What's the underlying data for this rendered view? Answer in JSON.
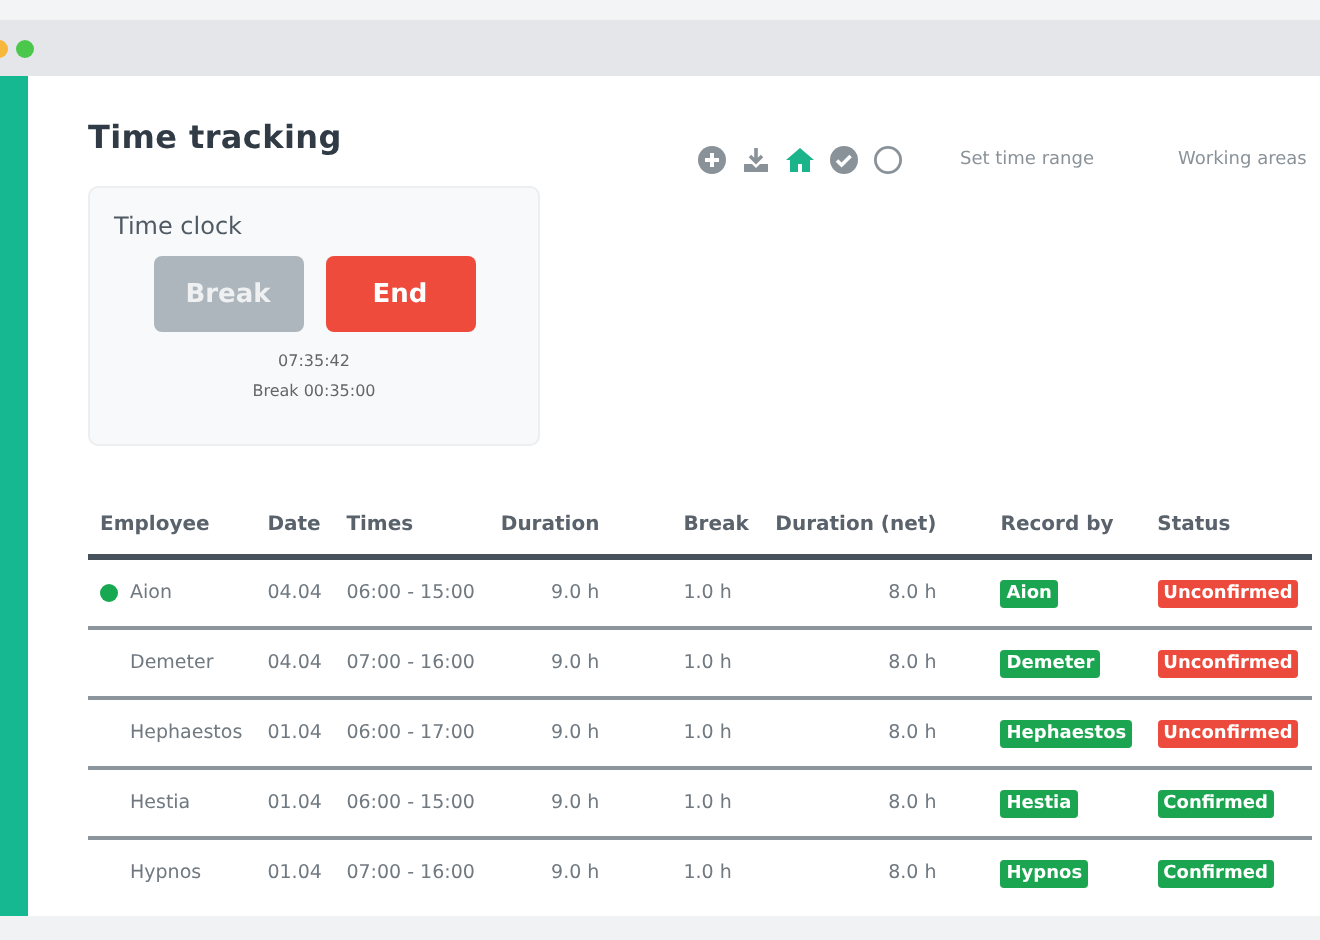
{
  "window": {
    "controls": [
      {
        "kind": "minimize"
      },
      {
        "kind": "maximize"
      }
    ]
  },
  "title": "Time tracking",
  "toolbar": {
    "icons": [
      {
        "kind": "add",
        "selected": false
      },
      {
        "kind": "download",
        "selected": false
      },
      {
        "kind": "home",
        "selected": true
      },
      {
        "kind": "check",
        "selected": false
      },
      {
        "kind": "circle",
        "selected": false
      }
    ],
    "links": [
      "Set time range",
      "Working areas"
    ]
  },
  "time_clock": {
    "title": "Time clock",
    "buttons": [
      {
        "label": "Break",
        "kind": "secondary"
      },
      {
        "label": "End",
        "kind": "danger"
      }
    ],
    "elapsed": "07:35:42",
    "break": "Break 00:35:00"
  },
  "table": {
    "columns": [
      "Employee",
      "Date",
      "Times",
      "Duration",
      "Break",
      "Duration (net)",
      "Record by",
      "Status"
    ],
    "rows": [
      {
        "employee": "Aion",
        "online": true,
        "date": "04.04",
        "times": "06:00 - 15:00",
        "duration": "9.0 h",
        "break": "1.0 h",
        "net": "8.0 h",
        "record_by": "Aion",
        "status": "Unconfirmed",
        "confirmed": false
      },
      {
        "employee": "Demeter",
        "online": false,
        "date": "04.04",
        "times": "07:00 - 16:00",
        "duration": "9.0 h",
        "break": "1.0 h",
        "net": "8.0 h",
        "record_by": "Demeter",
        "status": "Unconfirmed",
        "confirmed": false
      },
      {
        "employee": "Hephaestos",
        "online": false,
        "date": "01.04",
        "times": "06:00 - 17:00",
        "duration": "9.0 h",
        "break": "1.0 h",
        "net": "8.0 h",
        "record_by": "Hephaestos",
        "status": "Unconfirmed",
        "confirmed": false
      },
      {
        "employee": "Hestia",
        "online": false,
        "date": "01.04",
        "times": "06:00 - 15:00",
        "duration": "9.0 h",
        "break": "1.0 h",
        "net": "8.0 h",
        "record_by": "Hestia",
        "status": "Confirmed",
        "confirmed": true
      },
      {
        "employee": "Hypnos",
        "online": false,
        "date": "01.04",
        "times": "07:00 - 16:00",
        "duration": "9.0 h",
        "break": "1.0 h",
        "net": "8.0 h",
        "record_by": "Hypnos",
        "status": "Confirmed",
        "confirmed": true
      }
    ]
  }
}
